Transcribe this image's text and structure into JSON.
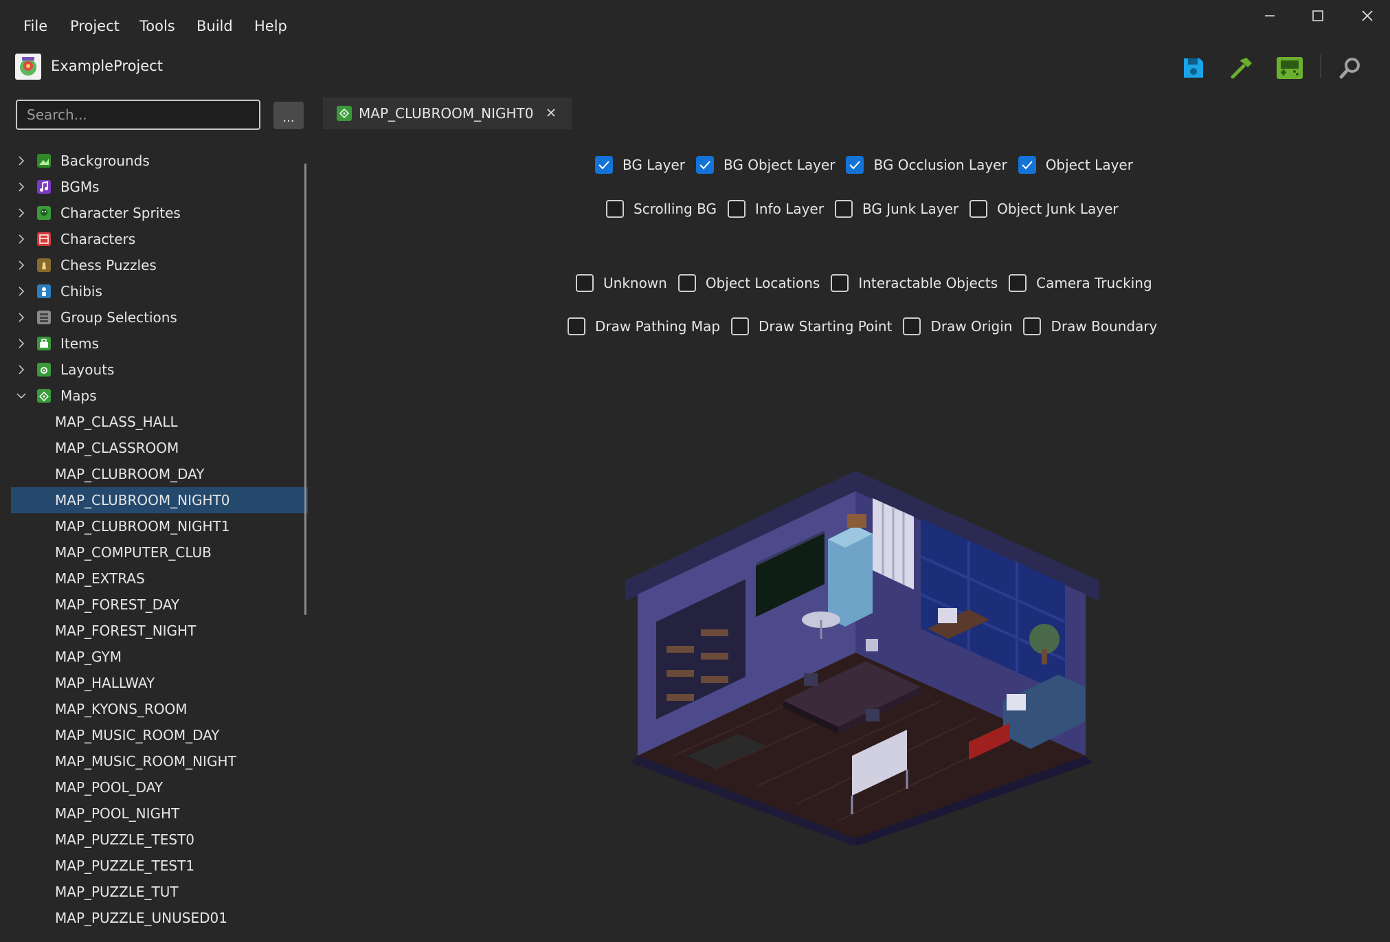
{
  "menu": [
    "File",
    "Project",
    "Tools",
    "Build",
    "Help"
  ],
  "project": {
    "name": "ExampleProject"
  },
  "toolbar": {
    "save": "save-icon",
    "build": "hammer-icon",
    "run": "gameboy-icon",
    "search": "search-icon"
  },
  "colors": {
    "accent": "#1473d6",
    "selected_row": "#24496d",
    "background": "#272727",
    "save_icon": "#1ba3e8",
    "build_icon": "#6ab02e"
  },
  "search": {
    "placeholder": "Search...",
    "more_label": "..."
  },
  "tree": {
    "categories": [
      {
        "label": "Backgrounds",
        "expanded": false
      },
      {
        "label": "BGMs",
        "expanded": false
      },
      {
        "label": "Character Sprites",
        "expanded": false
      },
      {
        "label": "Characters",
        "expanded": false
      },
      {
        "label": "Chess Puzzles",
        "expanded": false
      },
      {
        "label": "Chibis",
        "expanded": false
      },
      {
        "label": "Group Selections",
        "expanded": false
      },
      {
        "label": "Items",
        "expanded": false
      },
      {
        "label": "Layouts",
        "expanded": false
      },
      {
        "label": "Maps",
        "expanded": true
      }
    ],
    "maps": [
      "MAP_CLASS_HALL",
      "MAP_CLASSROOM",
      "MAP_CLUBROOM_DAY",
      "MAP_CLUBROOM_NIGHT0",
      "MAP_CLUBROOM_NIGHT1",
      "MAP_COMPUTER_CLUB",
      "MAP_EXTRAS",
      "MAP_FOREST_DAY",
      "MAP_FOREST_NIGHT",
      "MAP_GYM",
      "MAP_HALLWAY",
      "MAP_KYONS_ROOM",
      "MAP_MUSIC_ROOM_DAY",
      "MAP_MUSIC_ROOM_NIGHT",
      "MAP_POOL_DAY",
      "MAP_POOL_NIGHT",
      "MAP_PUZZLE_TEST0",
      "MAP_PUZZLE_TEST1",
      "MAP_PUZZLE_TUT",
      "MAP_PUZZLE_UNUSED01"
    ],
    "selected": "MAP_CLUBROOM_NIGHT0"
  },
  "tab": {
    "label": "MAP_CLUBROOM_NIGHT0"
  },
  "layers": {
    "row1": [
      {
        "label": "BG Layer",
        "checked": true
      },
      {
        "label": "BG Object Layer",
        "checked": true
      },
      {
        "label": "BG Occlusion Layer",
        "checked": true
      },
      {
        "label": "Object Layer",
        "checked": true
      }
    ],
    "row2": [
      {
        "label": "Scrolling BG",
        "checked": false
      },
      {
        "label": "Info Layer",
        "checked": false
      },
      {
        "label": "BG Junk Layer",
        "checked": false
      },
      {
        "label": "Object Junk Layer",
        "checked": false
      }
    ],
    "row3": [
      {
        "label": "Unknown",
        "checked": false
      },
      {
        "label": "Object Locations",
        "checked": false
      },
      {
        "label": "Interactable Objects",
        "checked": false
      },
      {
        "label": "Camera Trucking",
        "checked": false
      }
    ],
    "row4": [
      {
        "label": "Draw Pathing Map",
        "checked": false
      },
      {
        "label": "Draw Starting Point",
        "checked": false
      },
      {
        "label": "Draw Origin",
        "checked": false
      },
      {
        "label": "Draw Boundary",
        "checked": false
      }
    ]
  }
}
